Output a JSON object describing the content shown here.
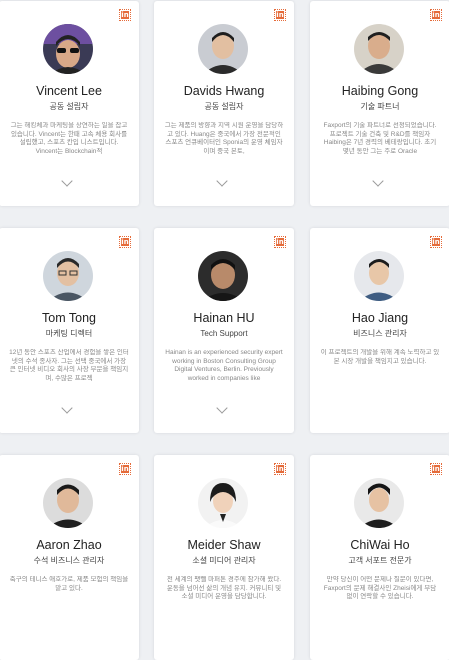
{
  "members": [
    {
      "name": "Vincent Lee",
      "role": "공동 설립자",
      "bio": "그는 해킹체과 마케팅을 상연하는 일을 잡고 있습니다. Vincent는 한때 고속 체용 회사를 설립했고, 스포츠 칸입 니스트입니다. Vincent는 Blockchain적"
    },
    {
      "name": "Davids Hwang",
      "role": "공동 설립자",
      "bio": "그는 제품의 방향과 지역 시원 운영을 담당하고 있다. Huang은 중국에서 가장 전문적인 스포츠 언큐베이터인 Sponia의 운영 체임자이며 중국 본토,"
    },
    {
      "name": "Haibing Gong",
      "role": "기술 파트너",
      "bio": "Faxport의 기술 파트너로 선정되었습니다. 프로젝트 기술 건축 및 R&D를 책임자 Haibing은 7년 경력의 베테랑입니다. 초기 몇년 동안 그는 주로 Oracle"
    },
    {
      "name": "Tom Tong",
      "role": "마케팅 디렉터",
      "bio": "12년 동안 스포츠 산업에서 경험을 쌓은 인터넷의 수석 종사자. 그는 선택 중국에서 가장 큰 인터넷 비디오 회사의 사장 부문을 책임지며, 수많은 프로젝"
    },
    {
      "name": "Hainan HU",
      "role": "Tech Support",
      "bio": "Hainan is an experienced security expert working in Boston Consulting Group Digital Ventures, Berlin. Previously worked in companies like"
    },
    {
      "name": "Hao Jiang",
      "role": "비즈니스 관리자",
      "bio": "이 프로젝트의 개발을 위해 계속 노력하고 있본 시장 개발을 책임지고 있습니다."
    },
    {
      "name": "Aaron Zhao",
      "role": "수석 비즈니스 관리자",
      "bio": "축구의 테니스 애호가로, 제품 모험의 책임을 맡고 있다."
    },
    {
      "name": "Meider Shaw",
      "role": "소셜 미디어 관리자",
      "bio": "전 세계의 팻뺄 마퍼톤 경주에 참가해 왔다. 운동을 넘어선 삶의 개념 유지. 커뮤니티 및 소셜 미디어 운영을 담당합니다."
    },
    {
      "name": "ChiWai Ho",
      "role": "고객 서포트 전문가",
      "bio": "만약 당신이 어떤 문제나 질문이 있다면, Faxport의 문제 해결사인 Zheisi에게 부담 없이 연락할 수 있습니다."
    }
  ],
  "linkedin_label": "in",
  "accent": "#e56b3a"
}
